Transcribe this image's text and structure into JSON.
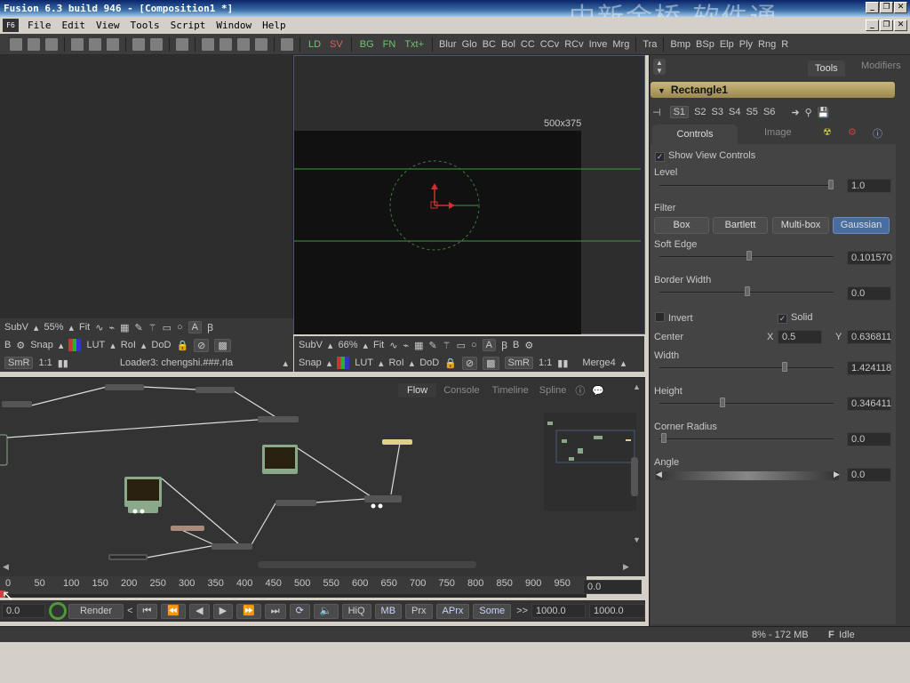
{
  "window": {
    "title": "Fusion 6.3 build 946 - [Composition1 *]"
  },
  "watermark": "中新金桥 软件通",
  "menu": [
    "File",
    "Edit",
    "View",
    "Tools",
    "Script",
    "Window",
    "Help"
  ],
  "toolbar": {
    "tools": [
      "LD",
      "SV",
      "BG",
      "FN",
      "Txt+",
      "Blur",
      "Glo",
      "BC",
      "Bol",
      "CC",
      "CCv",
      "RCv",
      "Inve",
      "Mrg",
      "Tra",
      "Bmp",
      "BSp",
      "Elp",
      "Ply",
      "Rng",
      "R"
    ]
  },
  "left_view": {
    "subv": "SubV",
    "zoom": "55%",
    "fit": "Fit",
    "b": "B",
    "snap": "Snap",
    "lut": "LUT",
    "roi": "RoI",
    "dod": "DoD",
    "smr": "SmR",
    "ratio": "1:1",
    "loader_label": "Loader3: chengshi.###.rla"
  },
  "right_view": {
    "resolution": "500x375",
    "subv": "SubV",
    "zoom": "66%",
    "fit": "Fit",
    "b": "B",
    "snap": "Snap",
    "lut": "LUT",
    "roi": "RoI",
    "dod": "DoD",
    "smr": "SmR",
    "ratio": "1:1",
    "view_label": "Merge4"
  },
  "flow": {
    "tabs": [
      "Flow",
      "Console",
      "Timeline",
      "Spline"
    ]
  },
  "timeline": {
    "ticks": [
      "0",
      "50",
      "100",
      "150",
      "200",
      "250",
      "300",
      "350",
      "400",
      "450",
      "500",
      "550",
      "600",
      "650",
      "700",
      "750",
      "800",
      "850",
      "900",
      "950"
    ],
    "current_time": "0.0",
    "start": "0.0",
    "render_label": "Render",
    "buttons": [
      "HiQ",
      "MB",
      "Prx",
      "APrx",
      "Some"
    ],
    "end_field": "1000.0",
    "global_end": "1000.0"
  },
  "status": {
    "memory": "8% - 172 MB",
    "state": "Idle"
  },
  "tools_panel": {
    "tabs": [
      "Tools",
      "Modifiers"
    ],
    "tool_name": "Rectangle1",
    "slots": [
      "S1",
      "S2",
      "S3",
      "S4",
      "S5",
      "S6"
    ],
    "subtabs": [
      "Controls",
      "Image"
    ],
    "show_view_controls": "Show View Controls",
    "level": {
      "label": "Level",
      "value": "1.0"
    },
    "filter": {
      "label": "Filter",
      "options": [
        "Box",
        "Bartlett",
        "Multi-box",
        "Gaussian"
      ],
      "selected": "Gaussian"
    },
    "soft_edge": {
      "label": "Soft Edge",
      "value": "0.101570"
    },
    "border_width": {
      "label": "Border Width",
      "value": "0.0"
    },
    "invert": "Invert",
    "solid": "Solid",
    "center": {
      "label": "Center",
      "x_label": "X",
      "x": "0.5",
      "y_label": "Y",
      "y": "0.636811"
    },
    "width": {
      "label": "Width",
      "value": "1.424118"
    },
    "height": {
      "label": "Height",
      "value": "0.346411"
    },
    "corner_radius": {
      "label": "Corner Radius",
      "value": "0.0"
    },
    "angle": {
      "label": "Angle",
      "value": "0.0"
    }
  }
}
